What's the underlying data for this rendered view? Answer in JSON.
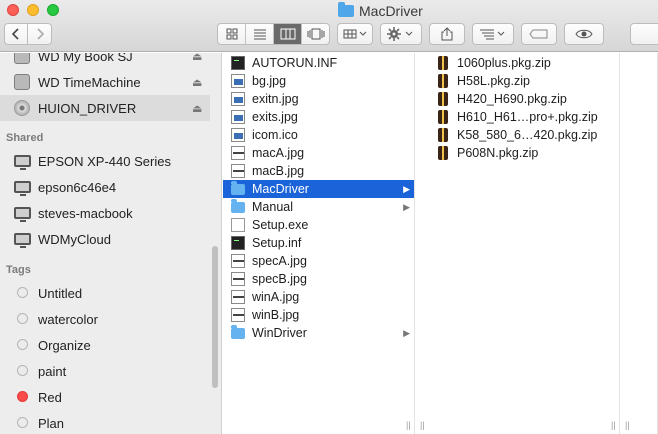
{
  "window": {
    "title": "MacDriver"
  },
  "toolbar": {
    "back_icon": "chevron-left-icon",
    "forward_icon": "chevron-right-icon",
    "views": [
      "icon-view",
      "list-view",
      "column-view",
      "cover-flow-view"
    ],
    "active_view": "column-view"
  },
  "sidebar": {
    "devices": [
      {
        "label": "WD My Book SJ",
        "icon": "external-disk-icon",
        "eject": true
      },
      {
        "label": "WD TimeMachine",
        "icon": "time-machine-disk-icon",
        "eject": true
      },
      {
        "label": "HUION_DRIVER",
        "icon": "optical-disk-icon",
        "eject": true,
        "selected": true
      }
    ],
    "shared_header": "Shared",
    "shared": [
      {
        "label": "EPSON XP-440 Series",
        "icon": "monitor-icon"
      },
      {
        "label": "epson6c46e4",
        "icon": "monitor-icon"
      },
      {
        "label": "steves-macbook",
        "icon": "monitor-icon"
      },
      {
        "label": "WDMyCloud",
        "icon": "monitor-icon"
      }
    ],
    "tags_header": "Tags",
    "tags": [
      {
        "label": "Untitled",
        "color": "#ececec"
      },
      {
        "label": "watercolor",
        "color": "#ececec"
      },
      {
        "label": "Organize",
        "color": "#ececec"
      },
      {
        "label": "paint",
        "color": "#ececec"
      },
      {
        "label": "Red",
        "color": "#fb4a4a"
      },
      {
        "label": "Plan",
        "color": "#ececec"
      }
    ]
  },
  "column1": [
    {
      "label": "AUTORUN.INF",
      "icon": "terminal-file-icon"
    },
    {
      "label": "bg.jpg",
      "icon": "image-file-icon"
    },
    {
      "label": "exitn.jpg",
      "icon": "image-file-icon"
    },
    {
      "label": "exits.jpg",
      "icon": "image-file-icon"
    },
    {
      "label": "icom.ico",
      "icon": "image-file-icon"
    },
    {
      "label": "macA.jpg",
      "icon": "image-file-icon"
    },
    {
      "label": "macB.jpg",
      "icon": "image-file-icon"
    },
    {
      "label": "MacDriver",
      "icon": "folder-icon",
      "folder": true,
      "selected": true
    },
    {
      "label": "Manual",
      "icon": "folder-icon",
      "folder": true
    },
    {
      "label": "Setup.exe",
      "icon": "document-icon"
    },
    {
      "label": "Setup.inf",
      "icon": "terminal-file-icon"
    },
    {
      "label": "specA.jpg",
      "icon": "image-file-icon"
    },
    {
      "label": "specB.jpg",
      "icon": "image-file-icon"
    },
    {
      "label": "winA.jpg",
      "icon": "image-file-icon"
    },
    {
      "label": "winB.jpg",
      "icon": "image-file-icon"
    },
    {
      "label": "WinDriver",
      "icon": "folder-icon",
      "folder": true
    }
  ],
  "column2": [
    {
      "label": "1060plus.pkg.zip",
      "icon": "zip-archive-icon"
    },
    {
      "label": "H58L.pkg.zip",
      "icon": "zip-archive-icon"
    },
    {
      "label": "H420_H690.pkg.zip",
      "icon": "zip-archive-icon"
    },
    {
      "label": "H610_H61…pro+.pkg.zip",
      "icon": "zip-archive-icon"
    },
    {
      "label": "K58_580_6…420.pkg.zip",
      "icon": "zip-archive-icon"
    },
    {
      "label": "P608N.pkg.zip",
      "icon": "zip-archive-icon"
    }
  ]
}
